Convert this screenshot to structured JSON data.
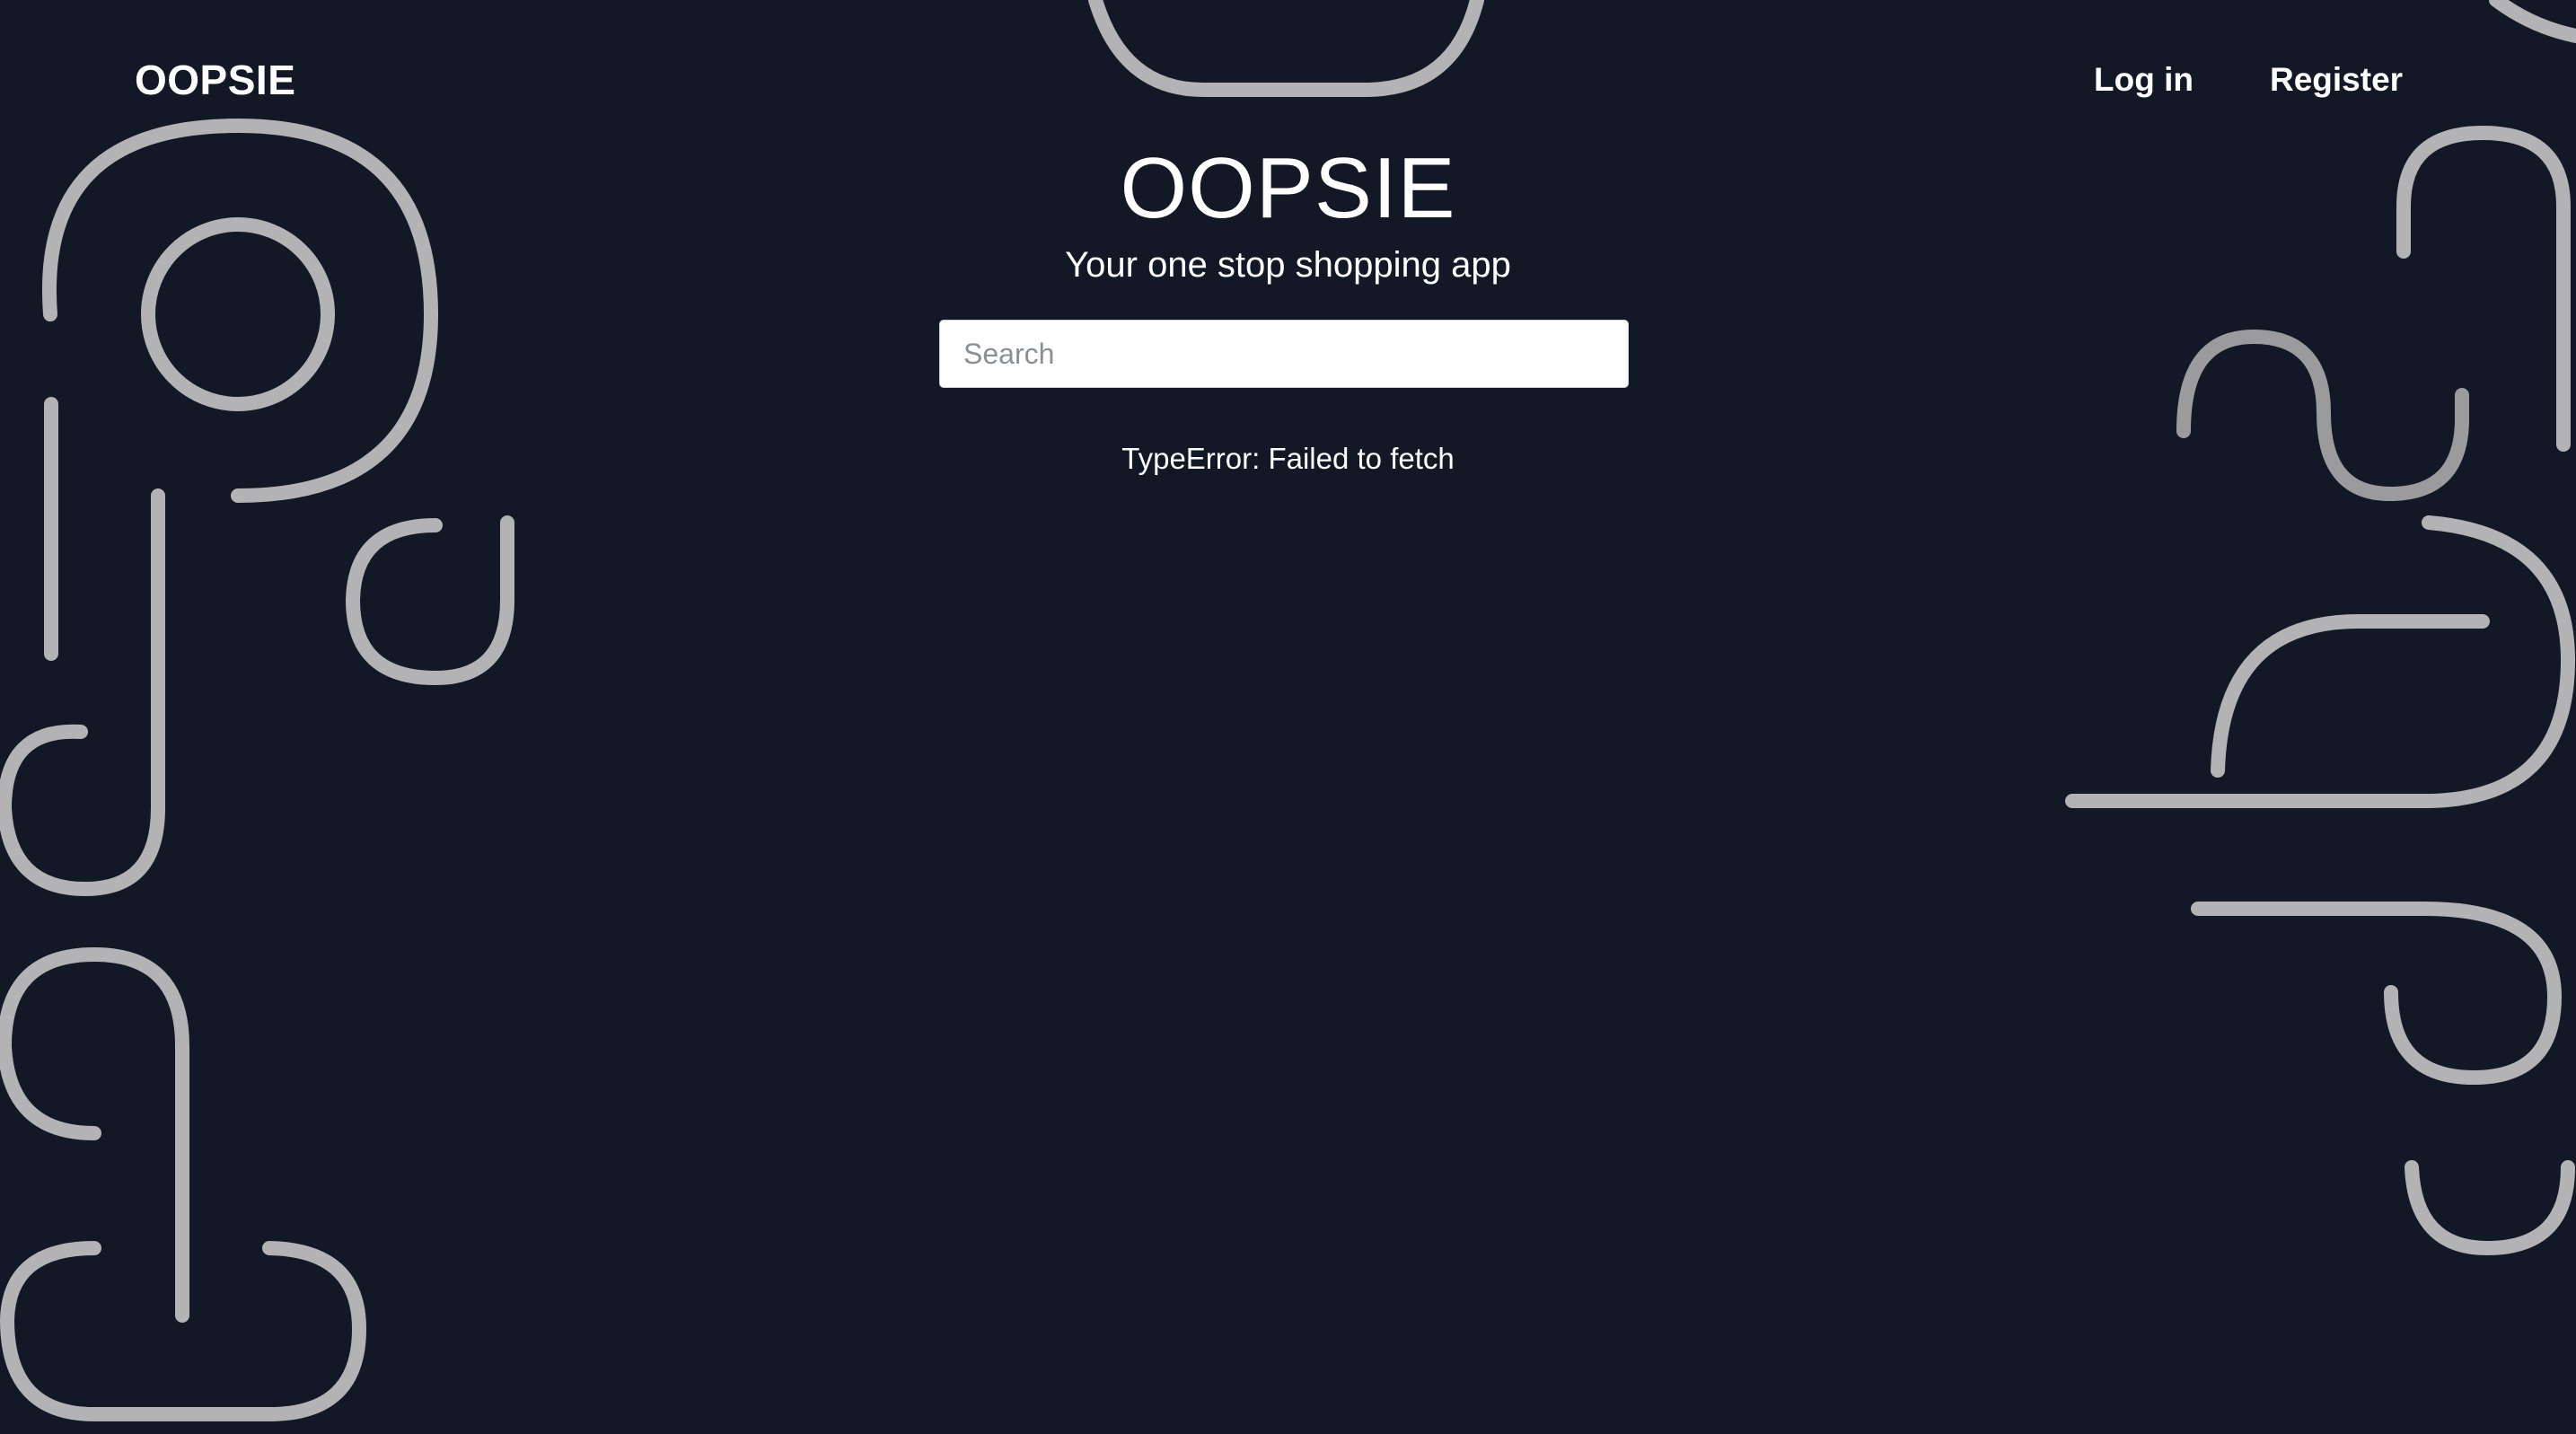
{
  "header": {
    "brand": "OOPSIE",
    "nav": {
      "login_label": "Log in",
      "register_label": "Register"
    }
  },
  "hero": {
    "title": "OOPSIE",
    "subtitle": "Your one stop shopping app"
  },
  "search": {
    "placeholder": "Search",
    "value": ""
  },
  "status": {
    "error_message": "TypeError: Failed to fetch"
  },
  "colors": {
    "background": "#131827",
    "text": "#ffffff",
    "decoration_stroke": "#b3b3b5"
  }
}
